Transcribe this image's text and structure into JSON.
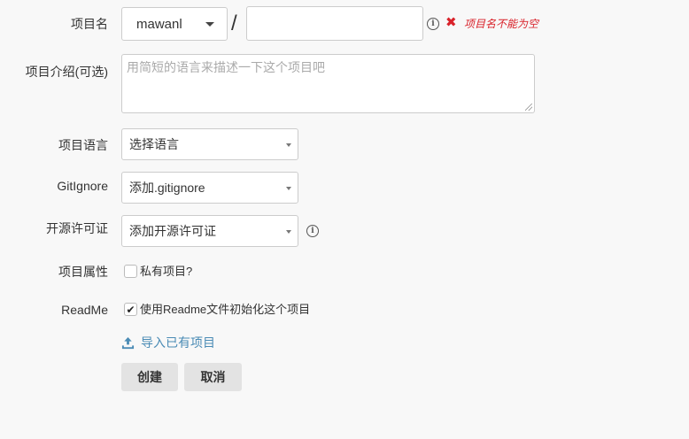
{
  "form": {
    "name_label": "项目名",
    "owner_value": "mawanl",
    "slash": "/",
    "name_value": "",
    "info_glyph": "i",
    "error_glyph": "✖",
    "name_error": "项目名不能为空",
    "desc_label": "项目介绍(可选)",
    "desc_placeholder": "用简短的语言来描述一下这个项目吧",
    "language_label": "项目语言",
    "language_value": "选择语言",
    "gitignore_label": "GitIgnore",
    "gitignore_value": "添加.gitignore",
    "license_label": "开源许可证",
    "license_value": "添加开源许可证",
    "visibility_label": "项目属性",
    "private_label": "私有项目?",
    "private_checked": false,
    "readme_label": "ReadMe",
    "readme_check_label": "使用Readme文件初始化这个项目",
    "readme_checked": true,
    "check_glyph": "✔",
    "import_label": "导入已有项目",
    "create_label": "创建",
    "cancel_label": "取消"
  },
  "colors": {
    "background": "#f8f8f8",
    "error": "#d9222a",
    "link": "#4a8bb5",
    "button_bg": "#e3e3e3"
  },
  "icons": {
    "info": "info-circle-icon",
    "error": "cross-icon",
    "upload": "upload-icon",
    "caret": "caret-down-icon"
  }
}
